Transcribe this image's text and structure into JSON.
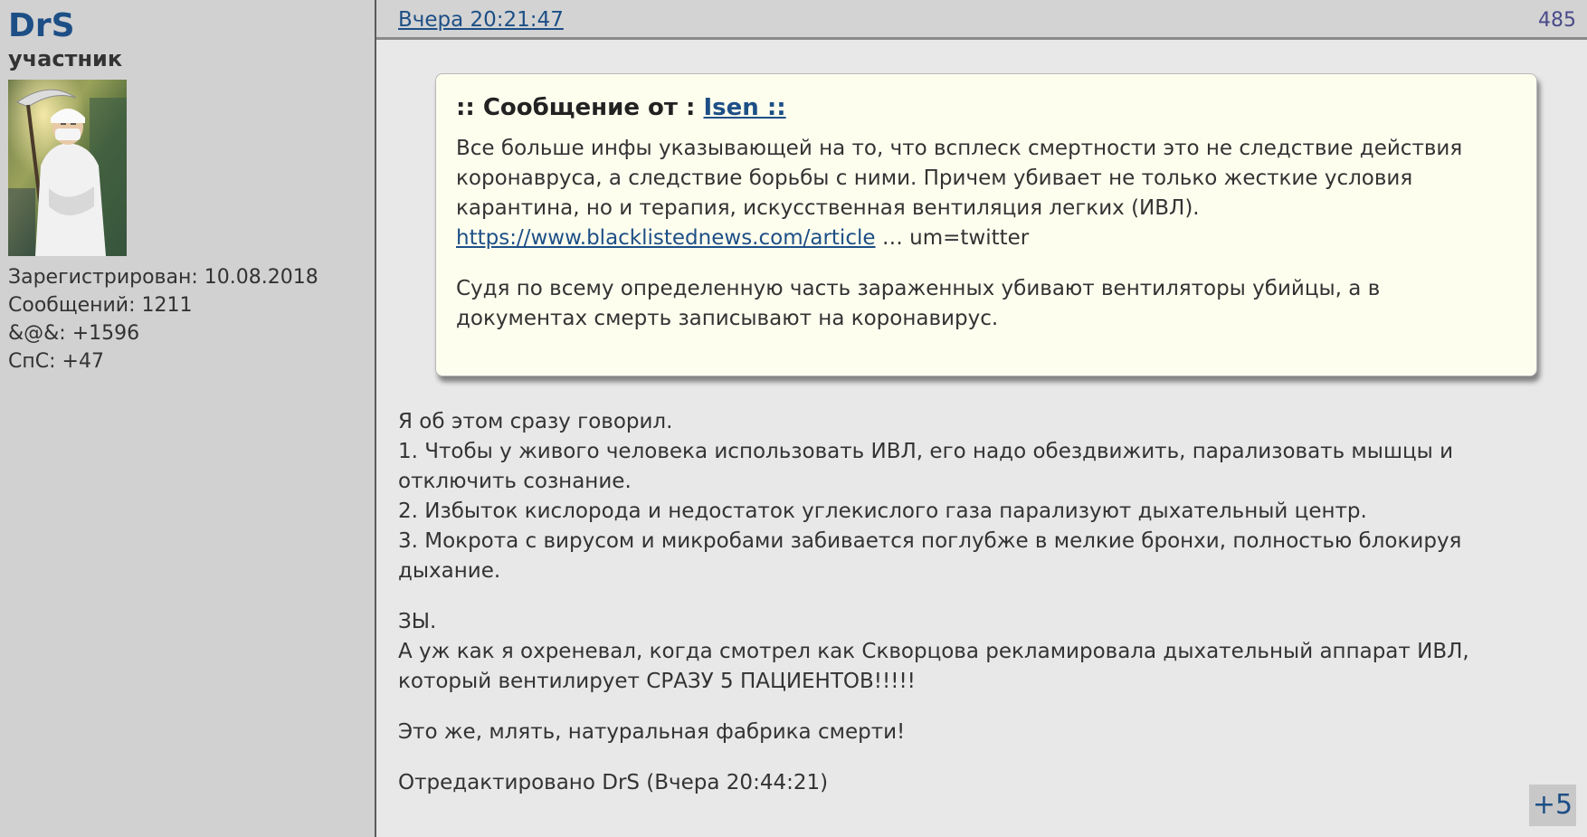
{
  "user": {
    "name": "DrS",
    "rank": "участник",
    "stats": [
      "Зарегистрирован: 10.08.2018",
      "Сообщений: 1211",
      "&@&: +1596",
      "СпС: +47"
    ]
  },
  "post": {
    "date": "Вчера 20:21:47",
    "number": "485",
    "quote": {
      "prefix": ":: Сообщение от : ",
      "author": "Isen ::",
      "line1": "Все больше инфы указывающей на то, что всплеск смертности это не следствие действия коронавруса, а следствие борьбы с ними. Причем убивает не только жесткие условия карантина, но и терапия, искусственная вентиляция легких (ИВЛ).",
      "link": "https://www.blacklistednews.com/article",
      "link_suffix": " … um=twitter",
      "line2": "Судя по всему определенную часть зараженных убивают вентиляторы убийцы, а в документах смерть записывают на коронавирус."
    },
    "body": {
      "intro": "Я об этом сразу говорил.",
      "point1": "1. Чтобы у живого человека использовать ИВЛ, его надо обездвижить, парализовать мышцы и отключить сознание.",
      "point2": "2. Избыток кислорода и недостаток углекислого газа парализуют дыхательный центр.",
      "point3": "3. Мокрота с вирусом и микробами забивается поглубже в мелкие бронхи, полностью блокируя дыхание.",
      "ps": "ЗЫ.",
      "ps_text": "А уж как я охреневал, когда смотрел как Скворцова рекламировала дыхательный аппарат ИВЛ, который вентилирует СРАЗУ 5 ПАЦИЕНТОВ!!!!!",
      "exclaim": "Это же, млять,  натуральная фабрика смерти!",
      "edited": "Отредактировано DrS (Вчера 20:44:21)"
    },
    "rating": "+5"
  },
  "colors": {
    "link": "#1d4f86",
    "sidebar_bg": "#d1d1d1",
    "content_bg": "#e8e8e8",
    "quote_bg": "#fefeef"
  },
  "icons": {
    "avatar": "avatar-doctor-with-scythe"
  }
}
